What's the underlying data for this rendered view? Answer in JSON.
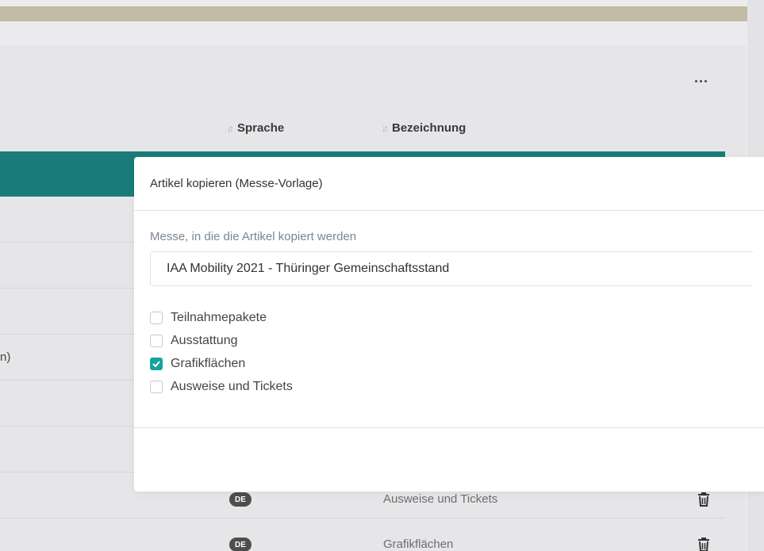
{
  "table": {
    "columns": {
      "sprache": "Sprache",
      "bezeichnung": "Bezeichnung"
    },
    "row_fragment": "n)",
    "rows": [
      {
        "language": "DE",
        "name": "Ausweise und Tickets"
      },
      {
        "language": "DE",
        "name": "Grafikflächen"
      }
    ]
  },
  "modal": {
    "title": "Artikel kopieren (Messe-Vorlage)",
    "target_label": "Messe, in die die Artikel kopiert werden",
    "target_value": "IAA Mobility 2021 - Thüringer Gemeinschaftsstand",
    "options": [
      {
        "label": "Teilnahmepakete",
        "checked": false
      },
      {
        "label": "Ausstattung",
        "checked": false
      },
      {
        "label": "Grafikflächen",
        "checked": true
      },
      {
        "label": "Ausweise und Tickets",
        "checked": false
      }
    ]
  },
  "colors": {
    "accent": "#17a2a0",
    "header_bar": "#1a7c78"
  },
  "icons": [
    "more-icon",
    "sort-icon",
    "trash-icon",
    "check-icon"
  ]
}
